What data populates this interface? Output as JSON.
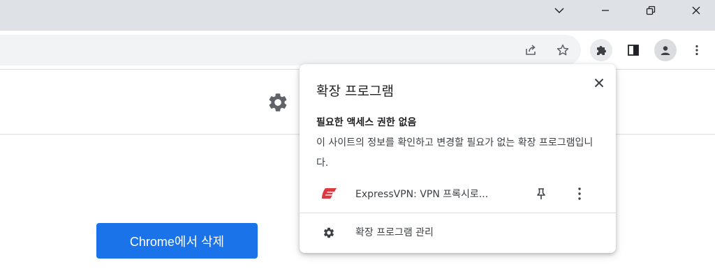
{
  "window": {
    "controls": {
      "tab_search": "tab-search",
      "minimize": "minimize",
      "restore": "restore",
      "close": "close"
    }
  },
  "toolbar": {
    "share_icon": "share-icon",
    "star_icon": "bookmark-star-icon",
    "extensions_icon": "puzzle-icon",
    "sidepanel_icon": "side-panel-icon",
    "profile_icon": "profile-icon",
    "menu_icon": "kebab-menu-icon"
  },
  "page": {
    "settings_icon": "gear-icon",
    "remove_button_label": "Chrome에서 삭제",
    "accent": "#1a73e8"
  },
  "extensions_popup": {
    "title": "확장 프로그램",
    "section_heading": "필요한 액세스 권한 없음",
    "section_description": "이 사이트의 정보를 확인하고 변경할 필요가 없는 확장 프로그램입니다.",
    "extension": {
      "name": "ExpressVPN: VPN 프록시로...",
      "brand_color": "#da3940"
    },
    "manage_label": "확장 프로그램 관리"
  }
}
